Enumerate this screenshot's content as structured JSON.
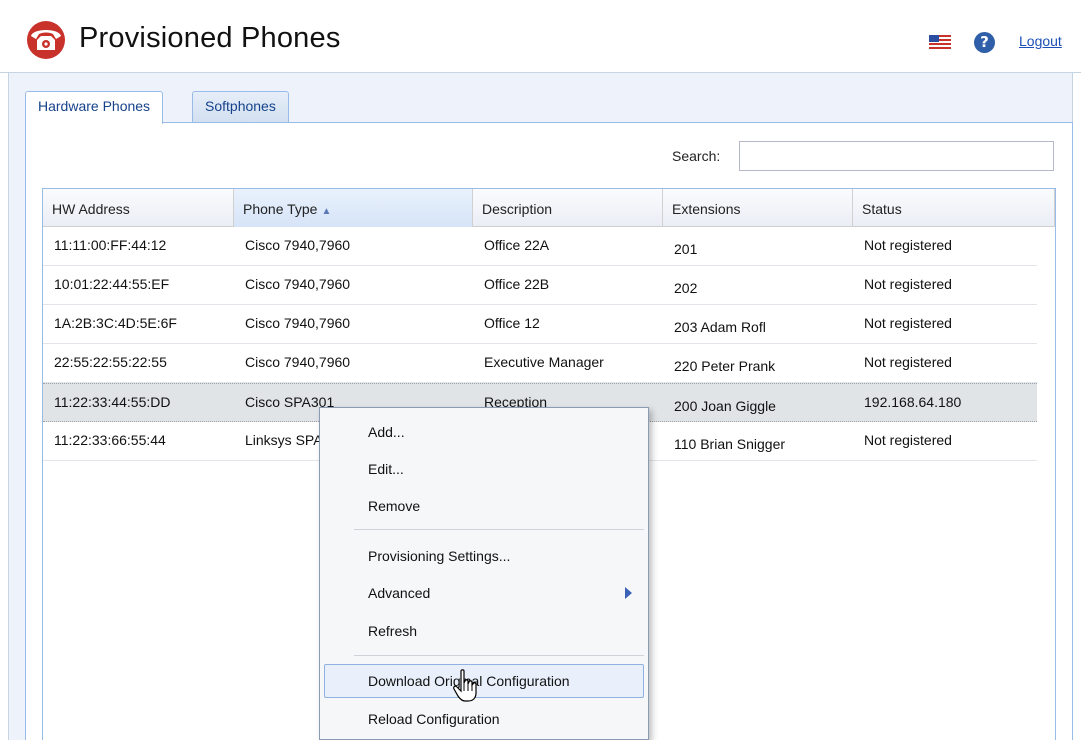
{
  "header": {
    "title": "Provisioned Phones",
    "logo_icon": "phone-logo-icon",
    "flag_icon": "us-flag-icon",
    "help_icon_glyph": "?",
    "logout_label": "Logout"
  },
  "tabs": [
    {
      "label": "Hardware Phones",
      "active": true
    },
    {
      "label": "Softphones",
      "active": false
    }
  ],
  "search": {
    "label": "Search:",
    "value": ""
  },
  "grid": {
    "columns": [
      "HW Address",
      "Phone Type",
      "Description",
      "Extensions",
      "Status"
    ],
    "sorted_column": "Phone Type",
    "sort_direction": "ascending",
    "rows": [
      {
        "hw": "11:11:00:FF:44:12",
        "type": "Cisco 7940,7960",
        "desc": "Office 22A",
        "ext": "201",
        "status": "Not registered"
      },
      {
        "hw": "10:01:22:44:55:EF",
        "type": "Cisco 7940,7960",
        "desc": "Office 22B",
        "ext": "202",
        "status": "Not registered"
      },
      {
        "hw": "1A:2B:3C:4D:5E:6F",
        "type": "Cisco 7940,7960",
        "desc": "Office 12",
        "ext": "203 Adam Rofl",
        "status": "Not registered"
      },
      {
        "hw": "22:55:22:55:22:55",
        "type": "Cisco 7940,7960",
        "desc": "Executive Manager",
        "ext": "220 Peter Prank",
        "status": "Not registered"
      },
      {
        "hw": "11:22:33:44:55:DD",
        "type": "Cisco SPA301",
        "desc": "Reception",
        "ext": "200 Joan Giggle",
        "status": "192.168.64.180",
        "selected": true
      },
      {
        "hw": "11:22:33:66:55:44",
        "type": "Linksys SPA",
        "desc": "",
        "ext": "110 Brian Snigger",
        "status": "Not registered"
      }
    ]
  },
  "context_menu": {
    "items": [
      "Add...",
      "Edit...",
      "Remove",
      "Provisioning Settings...",
      "Advanced",
      "Refresh",
      "Download Original Configuration",
      "Reload Configuration"
    ],
    "hovered_item": "Download Original Configuration",
    "submenu_item": "Advanced"
  },
  "colors": {
    "accent": "#15428b",
    "panel_bg": "#eef3fb",
    "border": "#99bbe8",
    "selected_row": "#e1e4e7",
    "logo_red": "#c8322b"
  }
}
